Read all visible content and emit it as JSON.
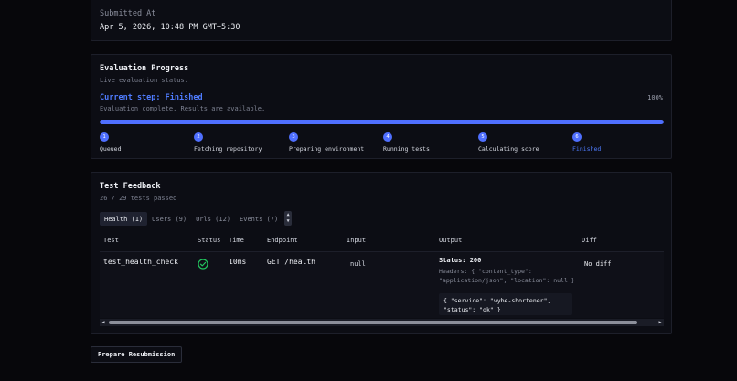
{
  "submitted": {
    "label": "Submitted At",
    "value": "Apr 5, 2026, 10:48 PM GMT+5:30"
  },
  "progress": {
    "title": "Evaluation Progress",
    "subtitle": "Live evaluation status.",
    "current_step": "Current step: Finished",
    "percent_text": "100%",
    "percent": 100,
    "message": "Evaluation complete. Results are available.",
    "stages": [
      {
        "num": "1",
        "name": "Queued"
      },
      {
        "num": "2",
        "name": "Fetching repository"
      },
      {
        "num": "3",
        "name": "Preparing environment"
      },
      {
        "num": "4",
        "name": "Running tests"
      },
      {
        "num": "5",
        "name": "Calculating score"
      },
      {
        "num": "6",
        "name": "Finished"
      }
    ]
  },
  "feedback": {
    "title": "Test Feedback",
    "summary": "26 / 29 tests passed",
    "tabs": [
      "Health (1)",
      "Users (9)",
      "Urls (12)",
      "Events (7)"
    ],
    "columns": [
      "Test",
      "Status",
      "Time",
      "Endpoint",
      "Input",
      "Output",
      "Diff"
    ],
    "row": {
      "test": "test_health_check",
      "status": "passed",
      "time": "10ms",
      "endpoint": "GET /health",
      "input": "null",
      "output_status": "Status: 200",
      "output_headers": "Headers: { \"content_type\": \"application/json\", \"location\": null }",
      "output_body": "{ \"service\": \"vybe-shortener\", \"status\": \"ok\" }",
      "diff": "No diff"
    }
  },
  "actions": {
    "resubmit": "Prepare Resubmission"
  },
  "colors": {
    "accent": "#4f6fff",
    "success": "#22c55e",
    "background": "#07070b"
  }
}
